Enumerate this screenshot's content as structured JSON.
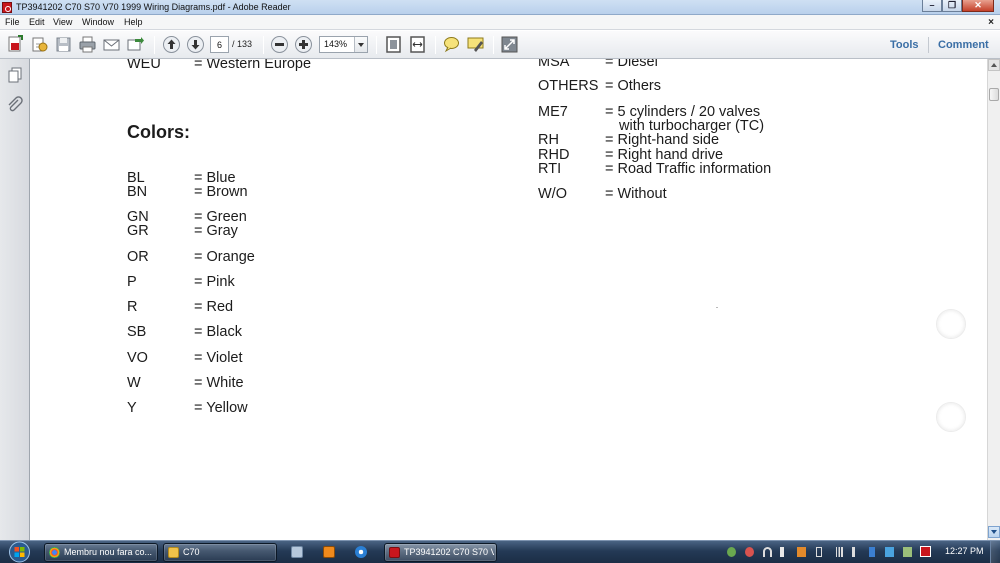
{
  "window": {
    "title": "TP3941202 C70 S70 V70 1999 Wiring Diagrams.pdf - Adobe Reader",
    "controls": [
      "minimize",
      "maximize",
      "close"
    ]
  },
  "menu": {
    "items": [
      "File",
      "Edit",
      "View",
      "Window",
      "Help"
    ],
    "close_doc": "×"
  },
  "toolbar": {
    "page_current": "6",
    "page_total": "/ 133",
    "zoom": "143%",
    "tools_label": "Tools",
    "comment_label": "Comment"
  },
  "document": {
    "top_left_row": {
      "code": "WEU",
      "desc": "= Western Europe"
    },
    "colors_heading": "Colors:",
    "colors": [
      {
        "code": "BL",
        "desc": "= Blue"
      },
      {
        "code": "BN",
        "desc": "= Brown"
      },
      {
        "code": "GN",
        "desc": "= Green"
      },
      {
        "code": "GR",
        "desc": "= Gray"
      },
      {
        "code": "OR",
        "desc": "= Orange"
      },
      {
        "code": "P",
        "desc": "= Pink"
      },
      {
        "code": "R",
        "desc": "= Red"
      },
      {
        "code": "SB",
        "desc": "= Black"
      },
      {
        "code": "VO",
        "desc": "= Violet"
      },
      {
        "code": "W",
        "desc": "= White"
      },
      {
        "code": "Y",
        "desc": "= Yellow"
      }
    ],
    "right_rows": [
      {
        "code": "MSA",
        "desc": "= Diesel"
      },
      {
        "code": "OTHERS",
        "desc": "= Others"
      },
      {
        "code": "ME7",
        "desc": "= 5 cylinders / 20 valves"
      },
      {
        "code": "",
        "desc": "with turbocharger (TC)"
      },
      {
        "code": "RH",
        "desc": "= Right-hand side"
      },
      {
        "code": "RHD",
        "desc": "= Right hand drive"
      },
      {
        "code": "RTI",
        "desc": "= Road Traffic information"
      },
      {
        "code": "W/O",
        "desc": "= Without"
      }
    ]
  },
  "taskbar": {
    "items": [
      {
        "label": "Membru nou fara co...",
        "icon": "chrome-icon",
        "active": false
      },
      {
        "label": "C70",
        "icon": "folder-icon",
        "active": false
      },
      {
        "label": "TP3941202 C70 S70 V...",
        "icon": "adobe-reader-icon",
        "active": true
      }
    ],
    "clock": "12:27 PM"
  },
  "colors": {
    "accent_link": "#3a6ea5",
    "taskbar": "#243a56",
    "adobe_red": "#c8161d"
  }
}
